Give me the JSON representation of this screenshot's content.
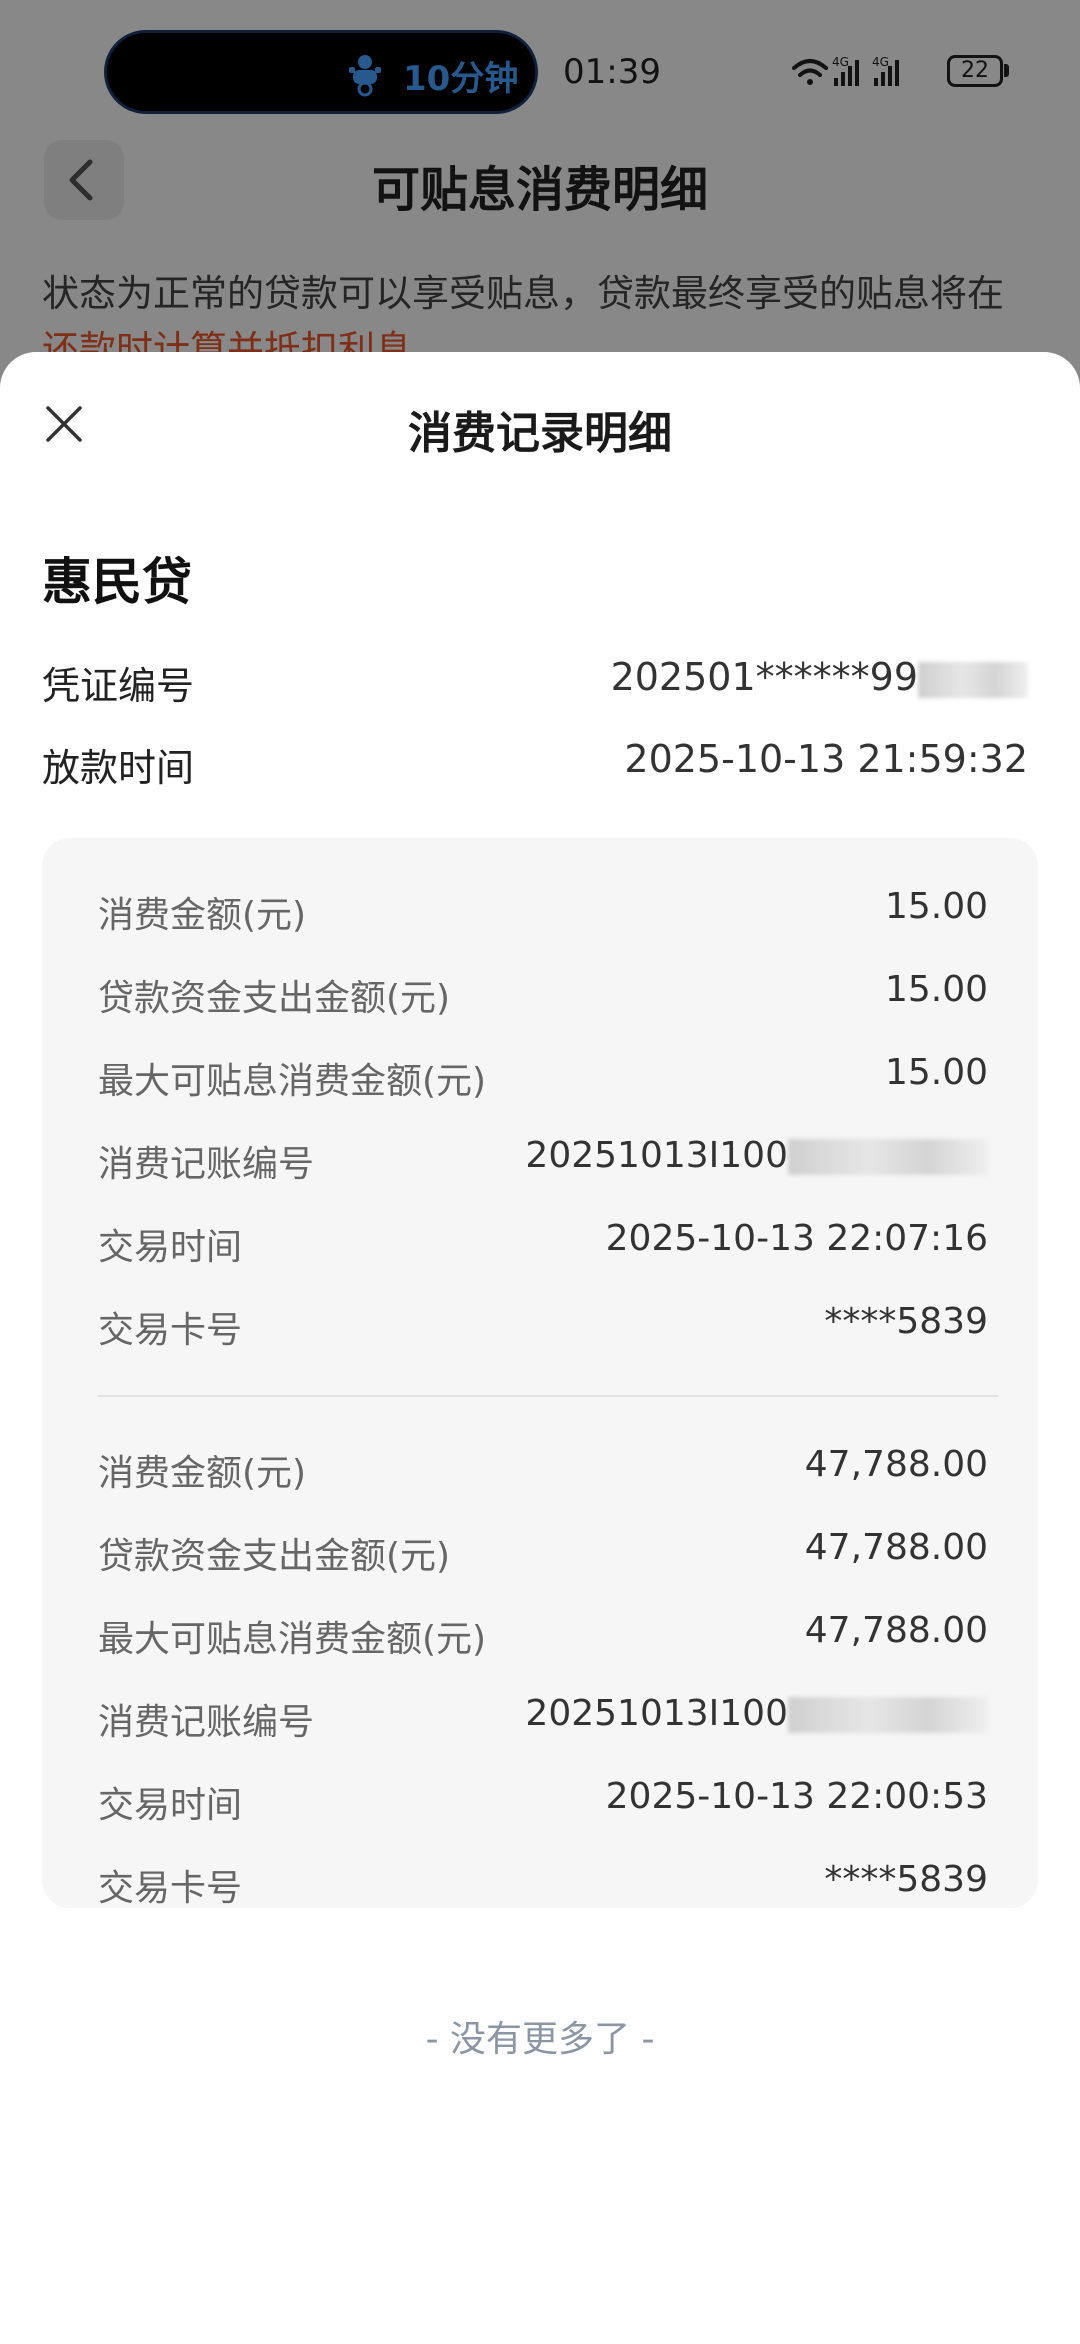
{
  "status_bar": {
    "timer_text": "10分钟",
    "clock": "01:39",
    "battery": "22",
    "network_labels": [
      "4G",
      "4G"
    ]
  },
  "background_page": {
    "title": "可贴息消费明细",
    "description_normal": "状态为正常的贷款可以享受贴息，贷款最终享受的贴息将在",
    "description_highlight": "还款时计算并抵扣利息"
  },
  "sheet": {
    "title": "消费记录明细",
    "product_name": "惠民贷",
    "voucher": {
      "label": "凭证编号",
      "value": "202501******99"
    },
    "loan_time": {
      "label": "放款时间",
      "value": "2025-10-13 21:59:32"
    }
  },
  "records": [
    {
      "rows": [
        {
          "label": "消费金额(元)",
          "value": "15.00"
        },
        {
          "label": "贷款资金支出金额(元)",
          "value": "15.00"
        },
        {
          "label": "最大可贴息消费金额(元)",
          "value": "15.00"
        },
        {
          "label": "消费记账编号",
          "value": "20251013I100"
        },
        {
          "label": "交易时间",
          "value": "2025-10-13 22:07:16"
        },
        {
          "label": "交易卡号",
          "value": "****5839"
        }
      ]
    },
    {
      "rows": [
        {
          "label": "消费金额(元)",
          "value": "47,788.00"
        },
        {
          "label": "贷款资金支出金额(元)",
          "value": "47,788.00"
        },
        {
          "label": "最大可贴息消费金额(元)",
          "value": "47,788.00"
        },
        {
          "label": "消费记账编号",
          "value": "20251013I100"
        },
        {
          "label": "交易时间",
          "value": "2025-10-13 22:00:53"
        },
        {
          "label": "交易卡号",
          "value": "****5839"
        }
      ]
    }
  ],
  "footer": {
    "no_more": "- 没有更多了 -"
  },
  "colors": {
    "accent": "#4aa3ff",
    "highlight": "#e8572a",
    "card_bg": "#f6f6f6"
  }
}
